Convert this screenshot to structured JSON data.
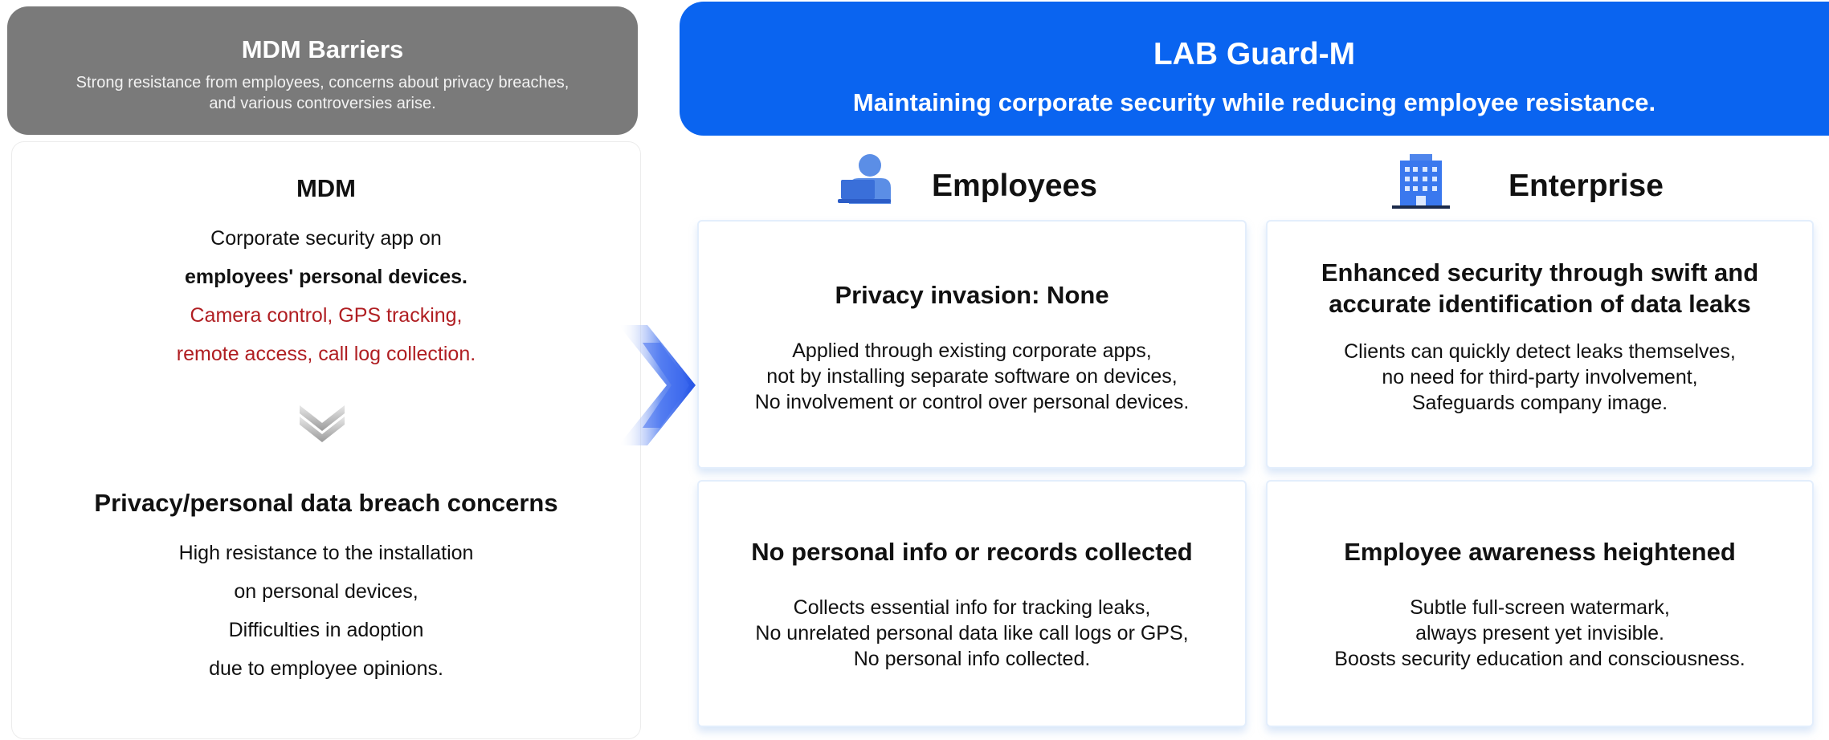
{
  "left_header": {
    "title": "MDM Barriers",
    "subtitle_line1": "Strong resistance from employees, concerns about privacy breaches,",
    "subtitle_line2": "and various controversies arise."
  },
  "left_card": {
    "title": "MDM",
    "line1": "Corporate security app on",
    "line2": "employees' personal devices.",
    "line3": "Camera control, GPS tracking,",
    "line4": "remote access, call log collection.",
    "arrow_icon": "double-chevron-down",
    "concern_title": "Privacy/personal data breach concerns",
    "concern_line1": "High resistance to the installation",
    "concern_line2": "on personal devices,",
    "concern_line3": "Difficulties in adoption",
    "concern_line4": "due to employee opinions."
  },
  "right_header": {
    "title": "LAB Guard-M",
    "subtitle": "Maintaining corporate security while reducing employee resistance."
  },
  "columns": {
    "employees": {
      "label": "Employees",
      "icon": "person-laptop-icon"
    },
    "enterprise": {
      "label": "Enterprise",
      "icon": "building-icon"
    }
  },
  "cards": {
    "privacy": {
      "title": "Privacy invasion: None",
      "line1": "Applied through existing corporate apps,",
      "line2": "not by installing separate software on devices,",
      "line3": "No involvement or control over personal devices."
    },
    "no_info": {
      "title": "No personal info or records collected",
      "line1": "Collects essential info for tracking leaks,",
      "line2": "No unrelated personal data like call logs or GPS,",
      "line3": "No personal info collected."
    },
    "security": {
      "title_line1": "Enhanced security through swift and",
      "title_line2": "accurate identification of data leaks",
      "line1": "Clients can quickly detect leaks themselves,",
      "line2": "no need for third-party involvement,",
      "line3": "Safeguards company image."
    },
    "awareness": {
      "title": "Employee awareness heightened",
      "line1": "Subtle full-screen watermark,",
      "line2": "always present yet invisible.",
      "line3": "Boosts security education and consciousness."
    }
  },
  "colors": {
    "brand_blue": "#0a64f0",
    "gray_header": "#7a7a7a",
    "alert_red": "#b01e22"
  }
}
